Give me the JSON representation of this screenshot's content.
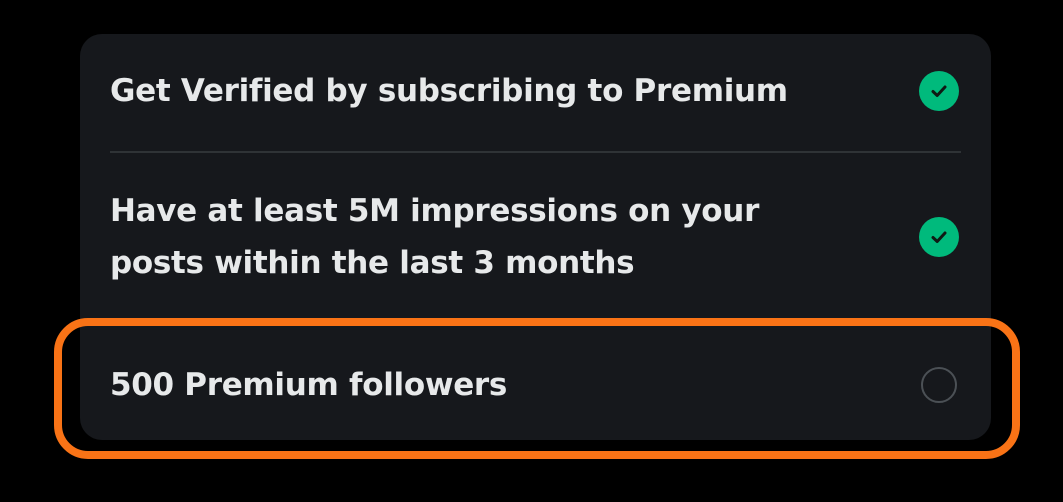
{
  "colors": {
    "accent": "#00ba7c",
    "highlight": "#f97316"
  },
  "requirements": [
    {
      "label": "Get Verified by subscribing to Premium",
      "status": "complete",
      "icon": "check-circle-icon"
    },
    {
      "label": "Have at least 5M impressions on your\nposts within the last 3 months",
      "status": "complete",
      "icon": "check-circle-icon"
    },
    {
      "label": "500 Premium followers",
      "status": "incomplete",
      "icon": "empty-circle-icon"
    }
  ]
}
